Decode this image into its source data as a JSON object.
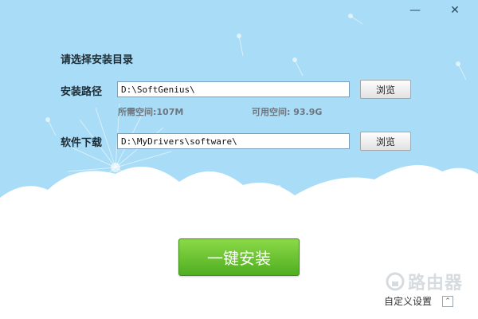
{
  "window": {
    "minimize_symbol": "—",
    "close_symbol": "✕"
  },
  "heading": "请选择安装目录",
  "install_path": {
    "label": "安装路径",
    "value": "D:\\SoftGenius\\",
    "browse_label": "浏览"
  },
  "space": {
    "required": "所需空间:107M",
    "available": "可用空间: 93.9G"
  },
  "download": {
    "label": "软件下载",
    "value": "D:\\MyDrivers\\software\\",
    "browse_label": "浏览"
  },
  "install_button": "一键安装",
  "custom_settings": {
    "label": "自定义设置",
    "toggle_symbol": "⌃"
  },
  "watermark": {
    "text": "路由器"
  },
  "colors": {
    "sky": "#a9dcf6",
    "install_green": "#5cbd28",
    "cloud": "#ffffff"
  }
}
